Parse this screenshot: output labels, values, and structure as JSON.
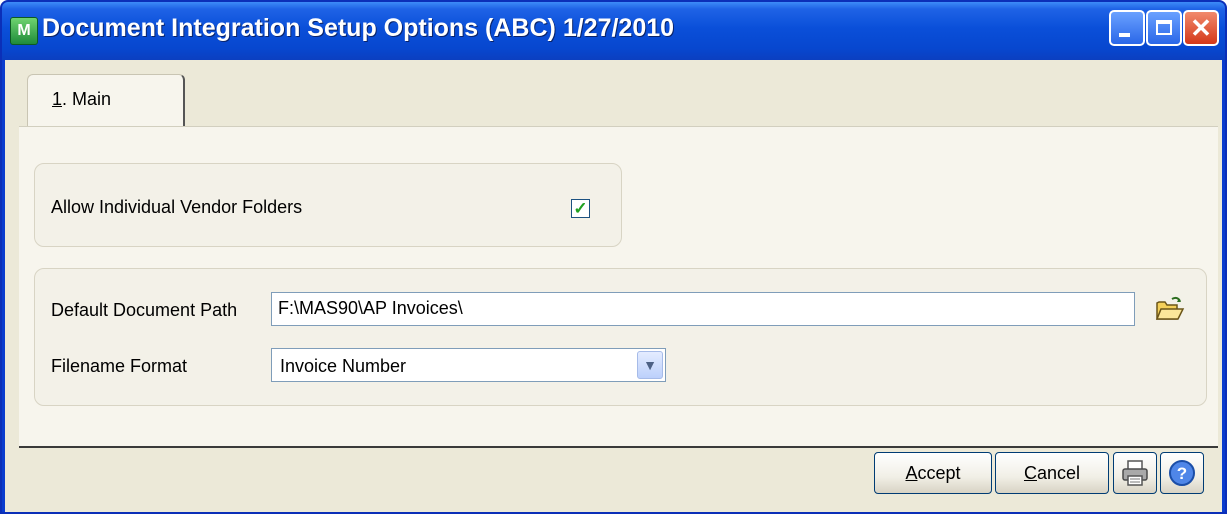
{
  "window": {
    "title": "Document Integration Setup Options (ABC) 1/27/2010",
    "app_icon_text": "M"
  },
  "tabs": [
    {
      "label": "1. Main",
      "hotkey": "1",
      "rest": ". Main",
      "selected": true
    }
  ],
  "vendor_folders": {
    "label": "Allow Individual Vendor Folders",
    "checked": true,
    "check_glyph": "✓"
  },
  "document_path": {
    "label": "Default Document Path",
    "value": "F:\\MAS90\\AP Invoices\\"
  },
  "filename_format": {
    "label": "Filename Format",
    "value": "Invoice Number",
    "arrow": "▼"
  },
  "buttons": {
    "accept": {
      "hotkey": "A",
      "rest": "ccept",
      "label": "Accept"
    },
    "cancel": {
      "hotkey": "C",
      "rest": "ancel",
      "label": "Cancel"
    }
  },
  "icons": {
    "app": "mas90-app-icon",
    "minimize": "minimize-icon",
    "maximize": "maximize-icon",
    "close": "close-icon",
    "folder": "folder-open-icon",
    "print": "printer-icon",
    "help": "help-icon"
  },
  "colors": {
    "title_bar": "#0a4fd9",
    "client_bg": "#ece9d8",
    "checkmark": "#21a121",
    "close_button": "#d4381a"
  }
}
